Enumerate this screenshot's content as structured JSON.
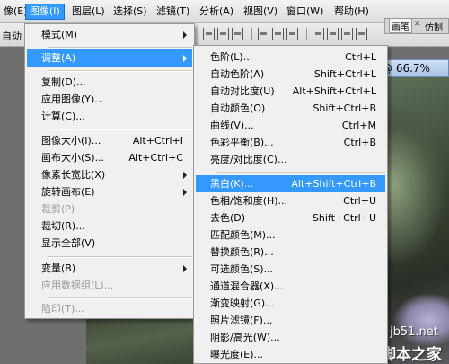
{
  "menubar": {
    "items": [
      {
        "label": "像(E)"
      },
      {
        "label": "图像(I)"
      },
      {
        "label": "图层(L)"
      },
      {
        "label": "选择(S)"
      },
      {
        "label": "滤镜(T)"
      },
      {
        "label": "分析(A)"
      },
      {
        "label": "视图(V)"
      },
      {
        "label": "窗口(W)"
      },
      {
        "label": "帮助(H)"
      }
    ]
  },
  "options": {
    "auto_label": "自动"
  },
  "panel": {
    "tab1": "画笔",
    "tab2": "仿制"
  },
  "document": {
    "zoom_title": "@ 66.7%"
  },
  "watermark": {
    "site": "jb51.net",
    "brand": "脚本之家"
  },
  "image_menu": {
    "mode": "模式(M)",
    "adjust": "调整(A)",
    "duplicate": "复制(D)...",
    "apply_image": "应用图像(Y)...",
    "calculations": "计算(C)...",
    "image_size": "图像大小(I)...",
    "image_size_sc": "Alt+Ctrl+I",
    "canvas_size": "画布大小(S)...",
    "canvas_size_sc": "Alt+Ctrl+C",
    "pixel_aspect": "像素长宽比(X)",
    "rotate_canvas": "旋转画布(E)",
    "crop": "裁剪(P)",
    "trim": "裁切(R)...",
    "reveal_all": "显示全部(V)",
    "variables": "变量(B)",
    "apply_dataset": "应用数据组(L)...",
    "trap": "陷印(T)..."
  },
  "adjust_menu": [
    {
      "label": "色阶(L)...",
      "shortcut": "Ctrl+L"
    },
    {
      "label": "自动色阶(A)",
      "shortcut": "Shift+Ctrl+L"
    },
    {
      "label": "自动对比度(U)",
      "shortcut": "Alt+Shift+Ctrl+L"
    },
    {
      "label": "自动颜色(O)",
      "shortcut": "Shift+Ctrl+B"
    },
    {
      "label": "曲线(V)...",
      "shortcut": "Ctrl+M"
    },
    {
      "label": "色彩平衡(B)...",
      "shortcut": "Ctrl+B"
    },
    {
      "label": "亮度/对比度(C)...",
      "shortcut": ""
    },
    {
      "label": "黑白(K)...",
      "shortcut": "Alt+Shift+Ctrl+B"
    },
    {
      "label": "色相/饱和度(H)...",
      "shortcut": "Ctrl+U"
    },
    {
      "label": "去色(D)",
      "shortcut": "Shift+Ctrl+U"
    },
    {
      "label": "匹配颜色(M)...",
      "shortcut": ""
    },
    {
      "label": "替换颜色(R)...",
      "shortcut": ""
    },
    {
      "label": "可选颜色(S)...",
      "shortcut": ""
    },
    {
      "label": "通道混合器(X)...",
      "shortcut": ""
    },
    {
      "label": "渐变映射(G)...",
      "shortcut": ""
    },
    {
      "label": "照片滤镜(F)...",
      "shortcut": ""
    },
    {
      "label": "阴影/高光(W)...",
      "shortcut": ""
    },
    {
      "label": "曝光度(E)...",
      "shortcut": ""
    }
  ],
  "colors": {
    "highlight": "#3399ff",
    "menu_bg": "#f0f0f0"
  }
}
